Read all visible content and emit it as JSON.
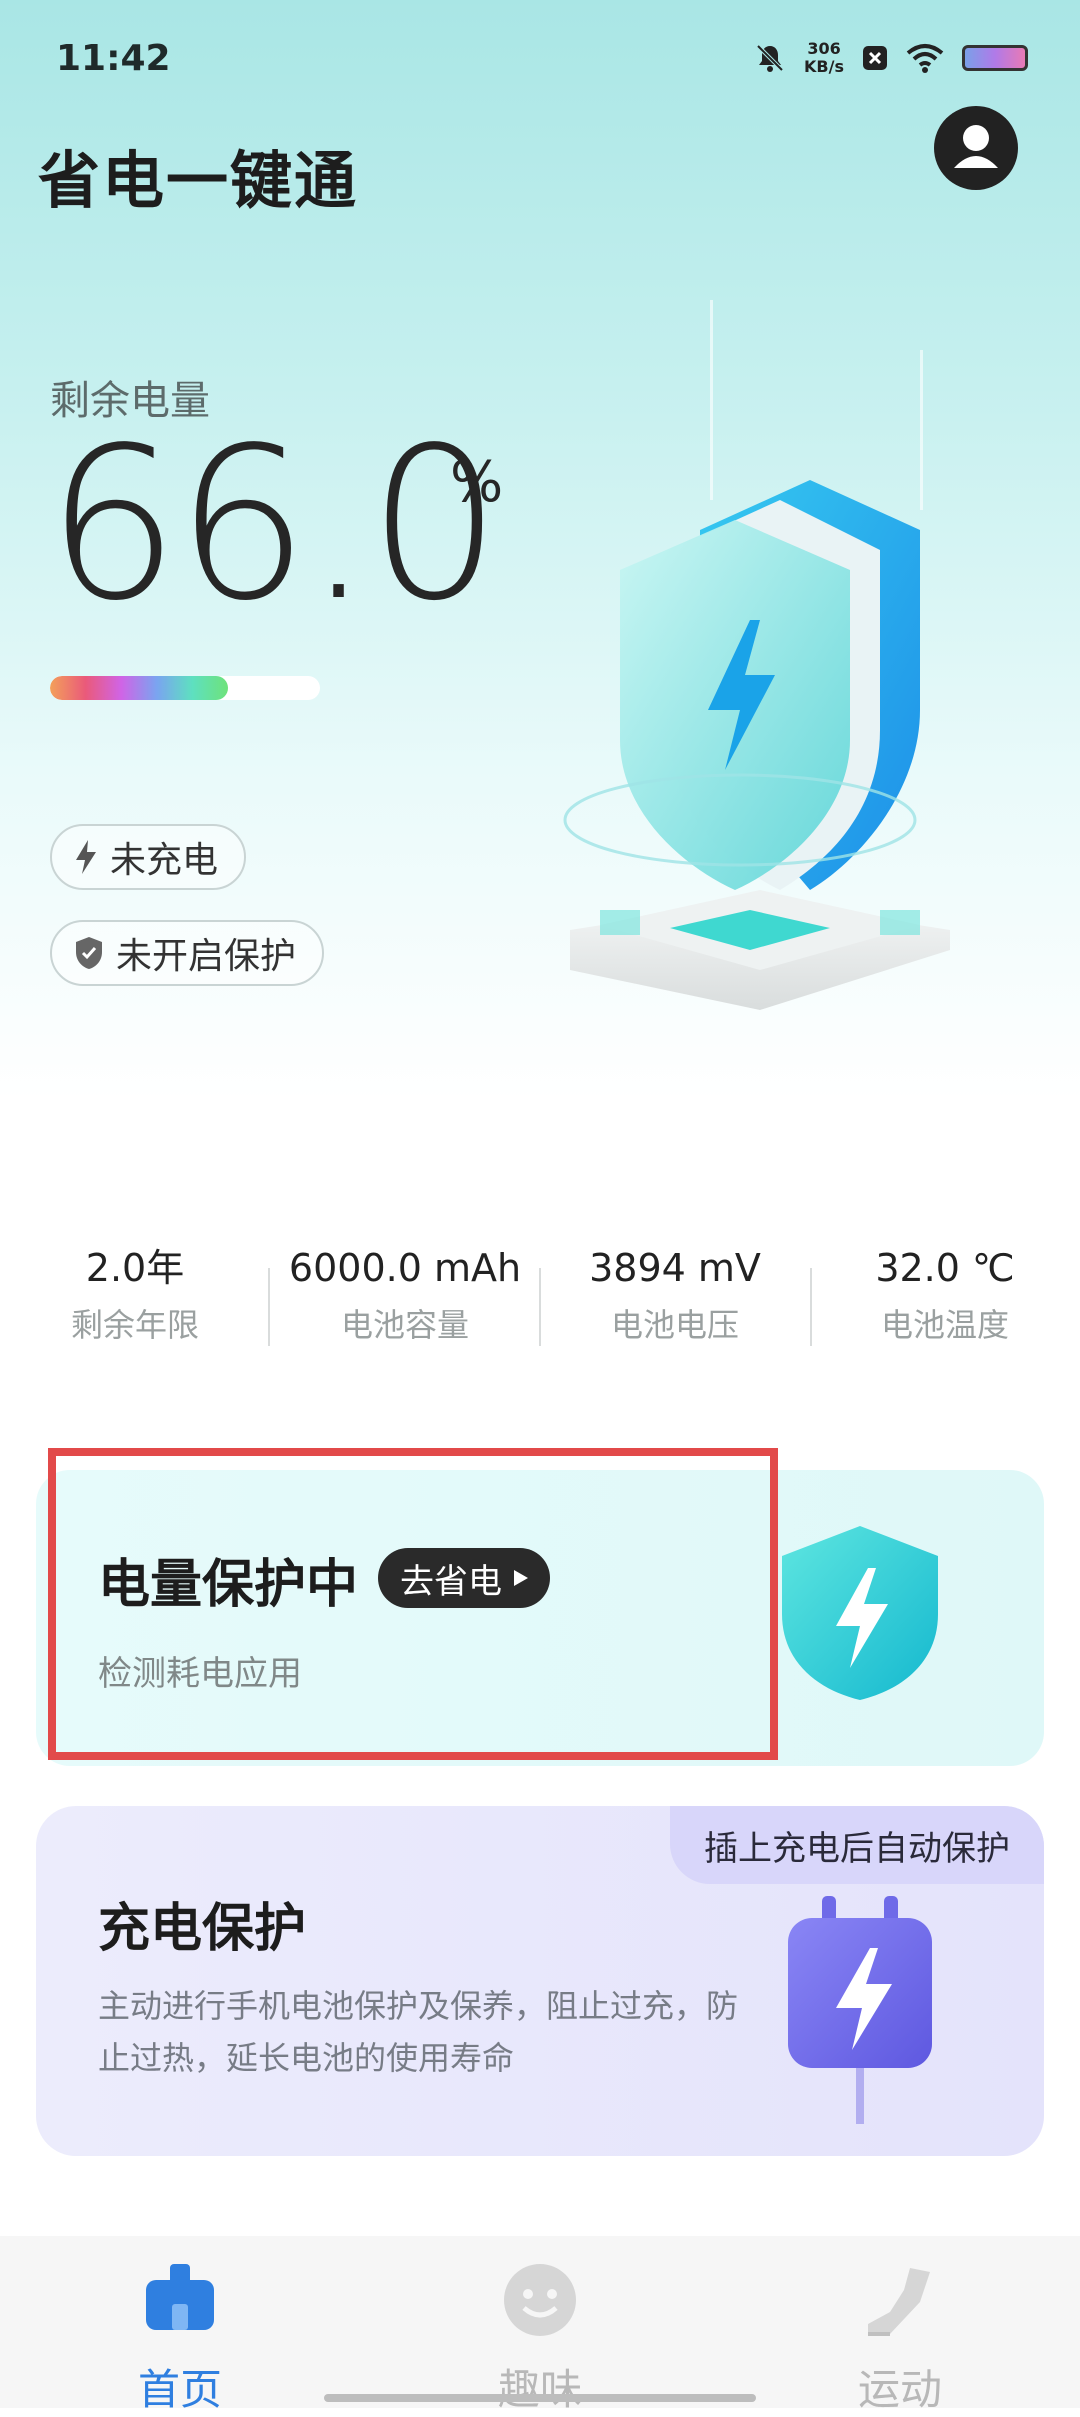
{
  "status_bar": {
    "time": "11:42",
    "net_speed_value": "306",
    "net_speed_unit": "KB/s"
  },
  "header": {
    "title": "省电一键通"
  },
  "battery": {
    "label": "剩余电量",
    "percent_value": "66.0",
    "percent_sign": "%",
    "level_fraction": 0.66,
    "charge_status": "未充电",
    "protect_status": "未开启保护"
  },
  "stats": [
    {
      "value": "2.0年",
      "label": "剩余年限"
    },
    {
      "value": "6000.0 mAh",
      "label": "电池容量"
    },
    {
      "value": "3894 mV",
      "label": "电池电压"
    },
    {
      "value": "32.0 ℃",
      "label": "电池温度"
    }
  ],
  "protect_card": {
    "title": "电量保护中",
    "button_label": "去省电",
    "subtitle": "检测耗电应用"
  },
  "charge_card": {
    "tag": "插上充电后自动保护",
    "title": "充电保护",
    "description": "主动进行手机电池保护及保养，阻止过充，防止过热，延长电池的使用寿命"
  },
  "tabbar": {
    "items": [
      {
        "label": "首页",
        "icon": "home-icon",
        "active": true
      },
      {
        "label": "趣味",
        "icon": "smile-icon",
        "active": false
      },
      {
        "label": "运动",
        "icon": "shoe-icon",
        "active": false
      }
    ],
    "active_color": "#2f7fe0",
    "inactive_color": "#b8b8b8"
  },
  "colors": {
    "accent": "#2f7fe0",
    "highlight_border": "#e24a4a"
  }
}
